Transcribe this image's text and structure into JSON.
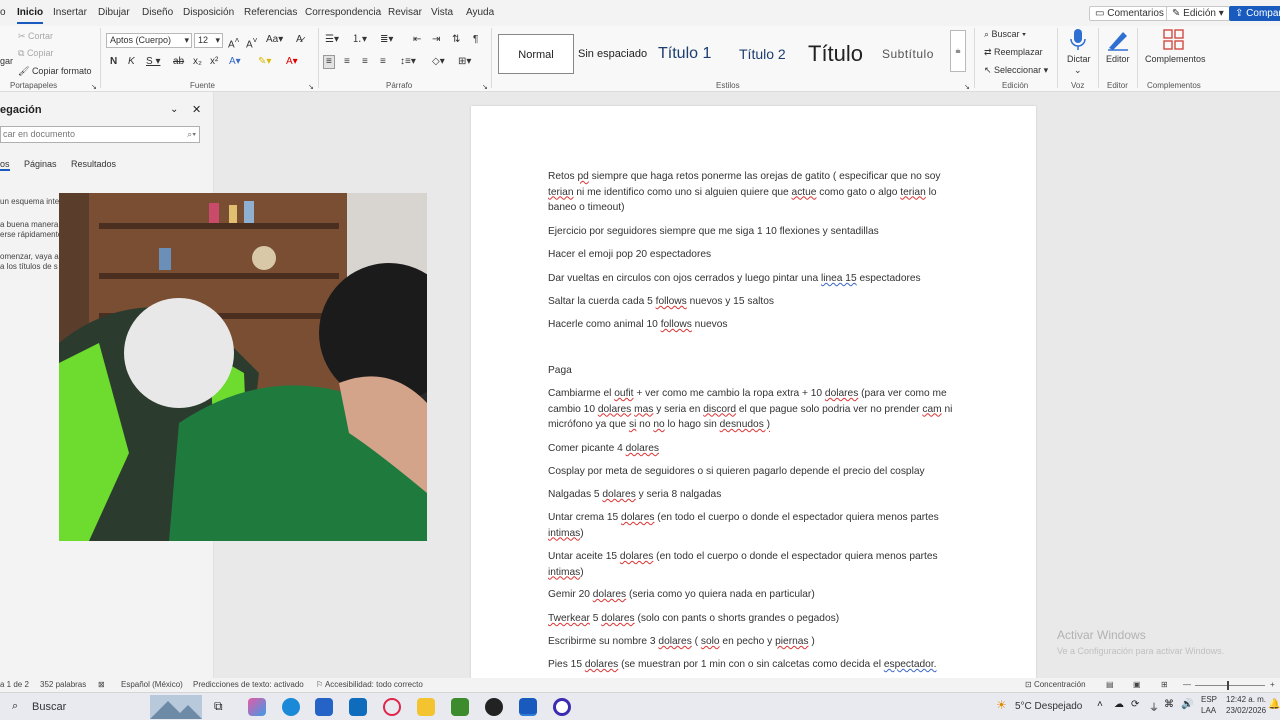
{
  "menu": {
    "tabs": [
      "o",
      "Inicio",
      "Insertar",
      "Dibujar",
      "Diseño",
      "Disposición",
      "Referencias",
      "Correspondencia",
      "Revisar",
      "Vista",
      "Ayuda"
    ],
    "comments": "Comentarios",
    "editing": "Edición",
    "share": "Compart"
  },
  "ribbon": {
    "clipboard": {
      "cut": "Cortar",
      "copy": "Copiar",
      "format": "Copiar formato",
      "paste": "gar",
      "label": "Portapapeles"
    },
    "font": {
      "name": "Aptos (Cuerpo)",
      "size": "12",
      "label": "Fuente"
    },
    "paragraph": {
      "label": "Párrafo"
    },
    "styles": {
      "items": [
        "Normal",
        "Sin espaciado",
        "Título 1",
        "Título 2",
        "Título",
        "Subtítulo"
      ],
      "label": "Estilos"
    },
    "editing": {
      "find": "Buscar",
      "replace": "Reemplazar",
      "select": "Seleccionar",
      "label": "Edición"
    },
    "voice": {
      "dictate": "Dictar",
      "label": "Voz"
    },
    "editor": {
      "button": "Editor",
      "label": "Editor"
    },
    "addins": {
      "button": "Complementos",
      "label": "Complementos"
    }
  },
  "nav": {
    "title": "egación",
    "search_placeholder": "car en documento",
    "tabs": [
      "os",
      "Páginas",
      "Resultados"
    ],
    "lines": [
      "un esquema inte",
      "a buena manera",
      "erse rápidamente",
      "omenzar, vaya a",
      "a los títulos de s"
    ]
  },
  "document": {
    "p1": [
      "Retos ",
      "pd",
      " siempre que haga retos ponerme las orejas de gatito ( especificar que no soy ",
      "terian",
      " ni me identifico como uno si alguien quiere que ",
      "actue",
      " como gato o algo ",
      "terian",
      " lo baneo o timeout)"
    ],
    "p2": "Ejercicio por seguidores siempre que me siga 1 10 flexiones y sentadillas",
    "p3": "Hacer el emoji pop 20 espectadores",
    "p4": [
      "Dar vueltas en circulos con ojos cerrados y luego pintar una ",
      "linea  15",
      " espectadores"
    ],
    "p5": [
      "Saltar la cuerda cada 5 ",
      "follows",
      " nuevos y 15 saltos"
    ],
    "p6": [
      "Hacerle como animal 10 ",
      "follows",
      " nuevos"
    ],
    "p7": "Paga",
    "p8": [
      "Cambiarme el ",
      "oufit",
      " + ver como me cambio la ropa extra + 10 ",
      "dolares",
      " (para ver como me cambio 10 ",
      "dolares",
      " ",
      "mas",
      " y seria en ",
      "discord",
      " el que pague solo podria ver no prender ",
      "cam",
      " ni micrófono ya que ",
      "si",
      " no ",
      "no",
      " lo hago sin ",
      "desnudos  )"
    ],
    "p9": [
      "Comer picante 4 ",
      "dolares"
    ],
    "p10": "Cosplay por meta de seguidores o si quieren pagarlo depende el precio del cosplay",
    "p11": [
      "Nalgadas 5 ",
      "dolares",
      " y seria 8 nalgadas"
    ],
    "p12": [
      "Untar crema 15 ",
      "dolares",
      " (en todo el cuerpo o donde el espectador quiera menos partes ",
      "intimas",
      ")"
    ],
    "p13": [
      "Untar aceite 15 ",
      "dolares",
      " (en todo el cuerpo o donde el espectador quiera menos partes ",
      "intimas",
      ")"
    ],
    "p14": [
      "Gemir 20 ",
      "dolares",
      " (seria como yo quiera nada en particular)"
    ],
    "p15": [
      "Twerkear",
      " 5 ",
      "dolares",
      " (solo con pants o shorts grandes o pegados)"
    ],
    "p16": [
      "Escribirme su nombre 3 ",
      "dolares",
      " ( ",
      "solo",
      " en pecho y ",
      "piernas",
      " )"
    ],
    "p17": [
      "Pies 15 ",
      "dolares",
      " (se muestran por 1 min con o sin calcetas como decida el ",
      "espectador."
    ]
  },
  "watermark": {
    "line1": "Activar Windows",
    "line2": "Ve a Configuración para activar Windows."
  },
  "status": {
    "page": "a 1 de 2",
    "words": "352 palabras",
    "language": "Español (México)",
    "predictions": "Predicciones de texto: activado",
    "accessibility": "Accesibilidad: todo correcto",
    "focus": "Concentración"
  },
  "taskbar": {
    "search": "Buscar",
    "weather": "5°C  Despejado",
    "lang1": "ESP",
    "lang2": "LAA",
    "time": "12:42 a. m.",
    "date": "23/02/2026"
  },
  "colors": {
    "accent": "#185abd",
    "spell_error": "#d33333",
    "grammar": "#3b66c6"
  }
}
